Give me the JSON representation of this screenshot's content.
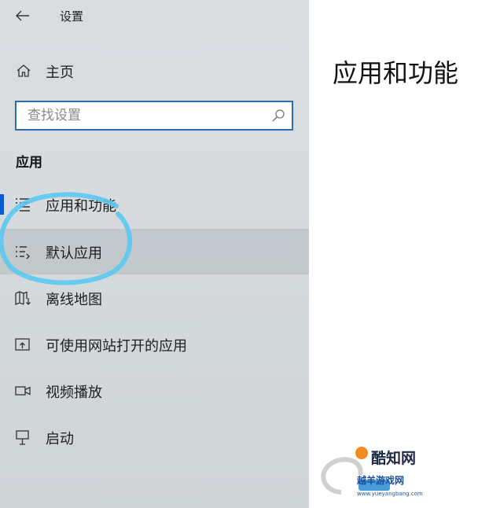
{
  "window": {
    "title": "设置"
  },
  "nav": {
    "home_label": "主页",
    "search_placeholder": "查找设置",
    "section_title": "应用",
    "items": [
      {
        "label": "应用和功能",
        "icon": "list-icon"
      },
      {
        "label": "默认应用",
        "icon": "default-apps-icon",
        "selected": true
      },
      {
        "label": "离线地图",
        "icon": "map-download-icon"
      },
      {
        "label": "可使用网站打开的应用",
        "icon": "open-in-app-icon"
      },
      {
        "label": "视频播放",
        "icon": "video-icon"
      },
      {
        "label": "启动",
        "icon": "startup-icon"
      }
    ]
  },
  "main": {
    "title": "应用和功能"
  },
  "watermark": {
    "line1": "酷知网",
    "line2": "越羊游戏网",
    "line3": "www.yueyangbang.com"
  },
  "colors": {
    "accent": "#0a5bd3",
    "annotation": "#5bc8f0",
    "search_border": "#2b6cb0"
  }
}
